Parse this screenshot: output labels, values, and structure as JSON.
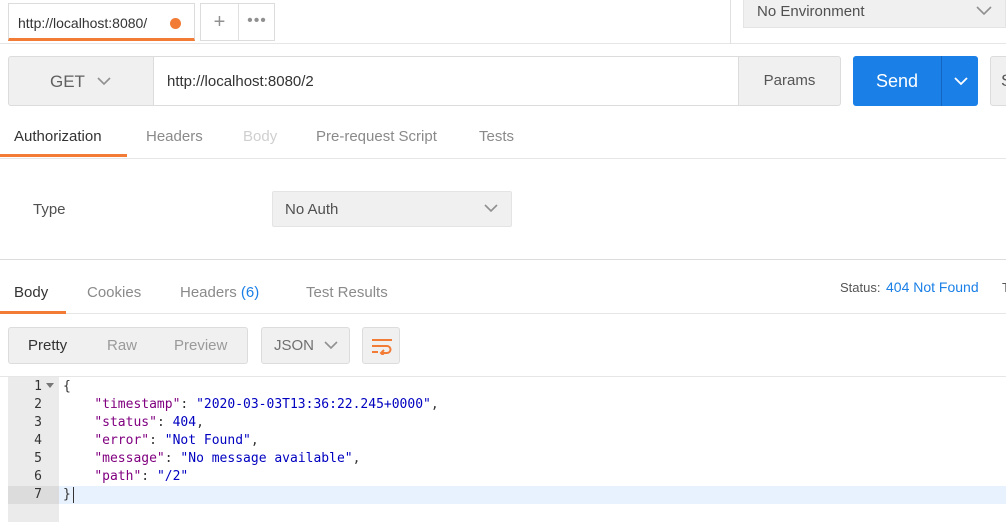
{
  "tabs": {
    "active_tab_label": "http://localhost:8080/",
    "new_tab_symbol": "+",
    "more_symbol": "•••"
  },
  "environment": {
    "selected": "No Environment"
  },
  "request": {
    "method": "GET",
    "url": "http://localhost:8080/2",
    "params_label": "Params",
    "send_label": "Send",
    "save_label_partial": "S"
  },
  "request_tabs": [
    "Authorization",
    "Headers",
    "Body",
    "Pre-request Script",
    "Tests"
  ],
  "auth": {
    "type_label": "Type",
    "type_value": "No Auth"
  },
  "response_tabs": {
    "body": "Body",
    "cookies": "Cookies",
    "headers": "Headers",
    "headers_count": "(6)",
    "test_results": "Test Results"
  },
  "status": {
    "label": "Status:",
    "value": "404 Not Found",
    "next_label_partial": "T"
  },
  "view_modes": [
    "Pretty",
    "Raw",
    "Preview"
  ],
  "format": "JSON",
  "code": {
    "line_numbers": [
      "1",
      "2",
      "3",
      "4",
      "5",
      "6",
      "7"
    ],
    "open_brace": "{",
    "close_brace": "}",
    "timestamp_key": "\"timestamp\"",
    "timestamp_value": "\"2020-03-03T13:36:22.245+0000\"",
    "status_key": "\"status\"",
    "status_value": "404",
    "error_key": "\"error\"",
    "error_value": "\"Not Found\"",
    "message_key": "\"message\"",
    "message_value": "\"No message available\"",
    "path_key": "\"path\"",
    "path_value": "\"/2\""
  },
  "colors": {
    "accent_orange": "#f27b35",
    "primary_blue": "#1a7fe6",
    "json_key": "#800080",
    "json_value": "#0000c0"
  },
  "icons": [
    "unsaved-dot-icon",
    "plus-icon",
    "more-icon",
    "chevron-down-icon",
    "wrap-lines-icon",
    "fold-arrow-icon"
  ]
}
